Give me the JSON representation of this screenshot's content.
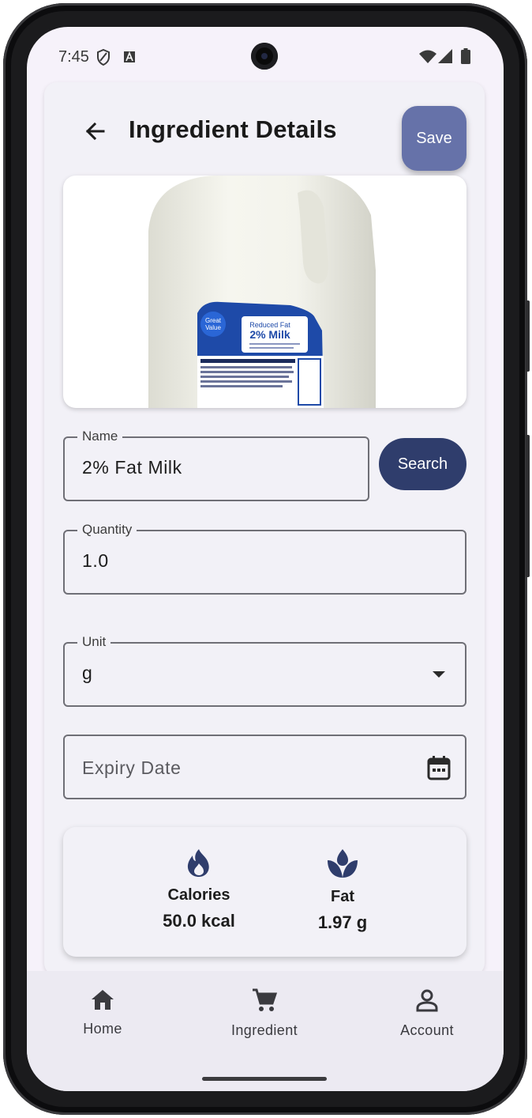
{
  "status_bar": {
    "time": "7:45"
  },
  "header": {
    "title": "Ingredient Details",
    "save_label": "Save"
  },
  "product_image": {
    "brand": "Great Value",
    "variant_line1": "Reduced Fat",
    "variant_line2": "2% Milk"
  },
  "form": {
    "name": {
      "label": "Name",
      "value": "2% Fat Milk"
    },
    "search_label": "Search",
    "quantity": {
      "label": "Quantity",
      "value": "1.0"
    },
    "unit": {
      "label": "Unit",
      "value": "g"
    },
    "expiry": {
      "placeholder": "Expiry Date"
    }
  },
  "nutrition": {
    "calories": {
      "label": "Calories",
      "value": "50.0 kcal",
      "icon": "flame-icon"
    },
    "fat": {
      "label": "Fat",
      "value": "1.97 g",
      "icon": "leaf-drop-icon"
    }
  },
  "bottom_nav": {
    "items": [
      {
        "label": "Home",
        "icon": "home-icon"
      },
      {
        "label": "Ingredient",
        "icon": "cart-icon"
      },
      {
        "label": "Account",
        "icon": "person-icon"
      }
    ]
  },
  "colors": {
    "primary_dark": "#2f3d6c",
    "primary_light": "#6672a9",
    "surface": "#f2f1f7",
    "nav_background": "#eceaf2"
  }
}
